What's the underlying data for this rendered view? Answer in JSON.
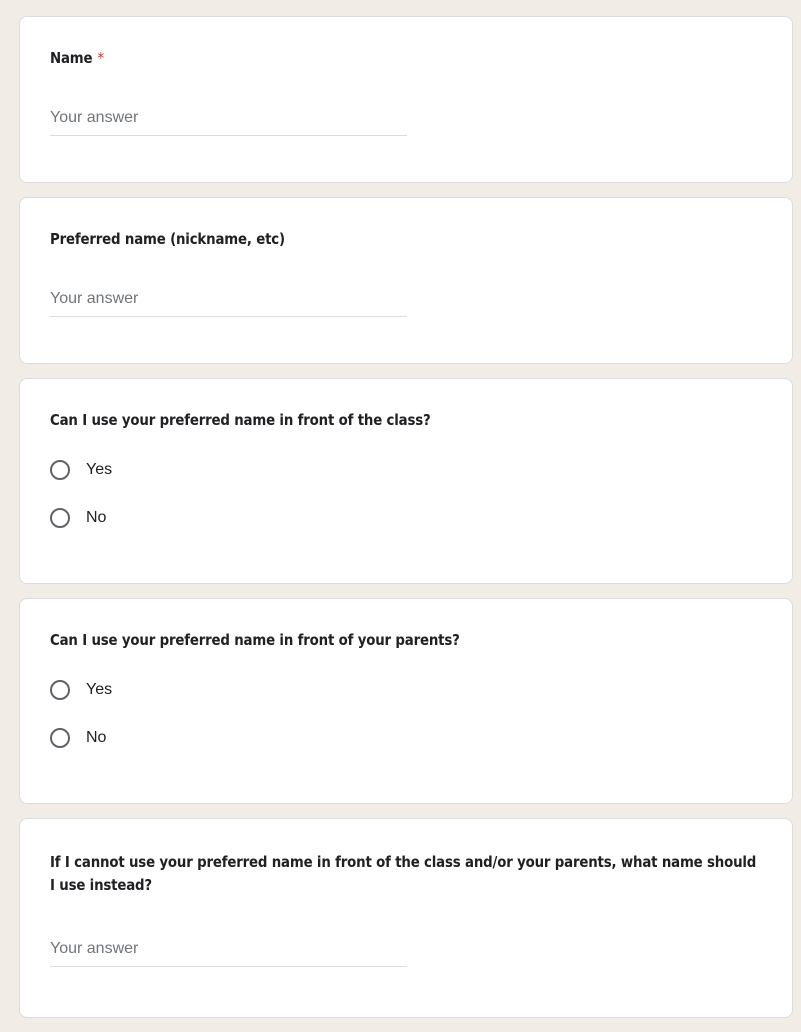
{
  "questions": [
    {
      "title": "Name",
      "required_mark": "*",
      "type": "text",
      "placeholder": "Your answer"
    },
    {
      "title": "Preferred name (nickname, etc)",
      "type": "text",
      "placeholder": "Your answer"
    },
    {
      "title": "Can I use your preferred name in front of the class?",
      "type": "radio",
      "options": [
        "Yes",
        "No"
      ]
    },
    {
      "title": "Can I use your preferred name in front of your parents?",
      "type": "radio",
      "options": [
        "Yes",
        "No"
      ]
    },
    {
      "title": "If I cannot use your preferred name in front of the class and/or your parents, what name should I use instead?",
      "type": "text",
      "placeholder": "Your answer"
    }
  ],
  "colors": {
    "background": "#f1ede6",
    "card": "#ffffff",
    "required": "#d93025",
    "placeholder": "#70757a",
    "radio_border": "#5f6368"
  }
}
